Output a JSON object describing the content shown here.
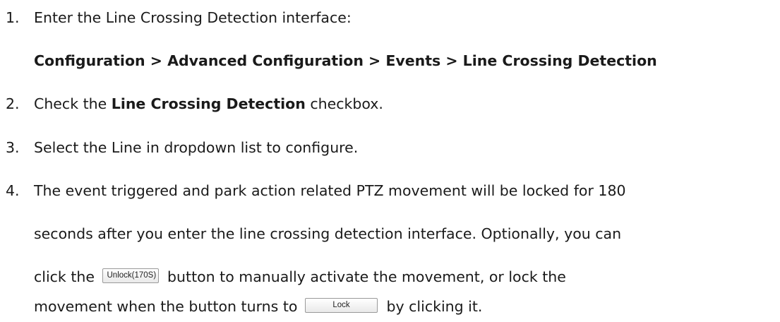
{
  "steps": [
    {
      "number": "1.",
      "text": "Enter the Line Crossing Detection interface:"
    },
    {
      "path": "Configuration > Advanced Configuration > Events > Line Crossing Detection"
    },
    {
      "number": "2.",
      "before": "Check the ",
      "bold": "Line Crossing Detection",
      "after": " checkbox."
    },
    {
      "number": "3.",
      "text": "Select the Line in dropdown list to configure."
    },
    {
      "number": "4.",
      "line1": "The event triggered and park action related PTZ movement will be locked for 180",
      "line2": "seconds after you enter the line crossing detection interface. Optionally, you can",
      "line3_before": "click the",
      "unlock_button_label": "Unlock(170S)",
      "line3_after": "button to manually activate the movement, or lock the",
      "line4_before": "movement when the button turns to",
      "lock_button_label": "Lock",
      "line4_after": "by clicking it."
    }
  ]
}
